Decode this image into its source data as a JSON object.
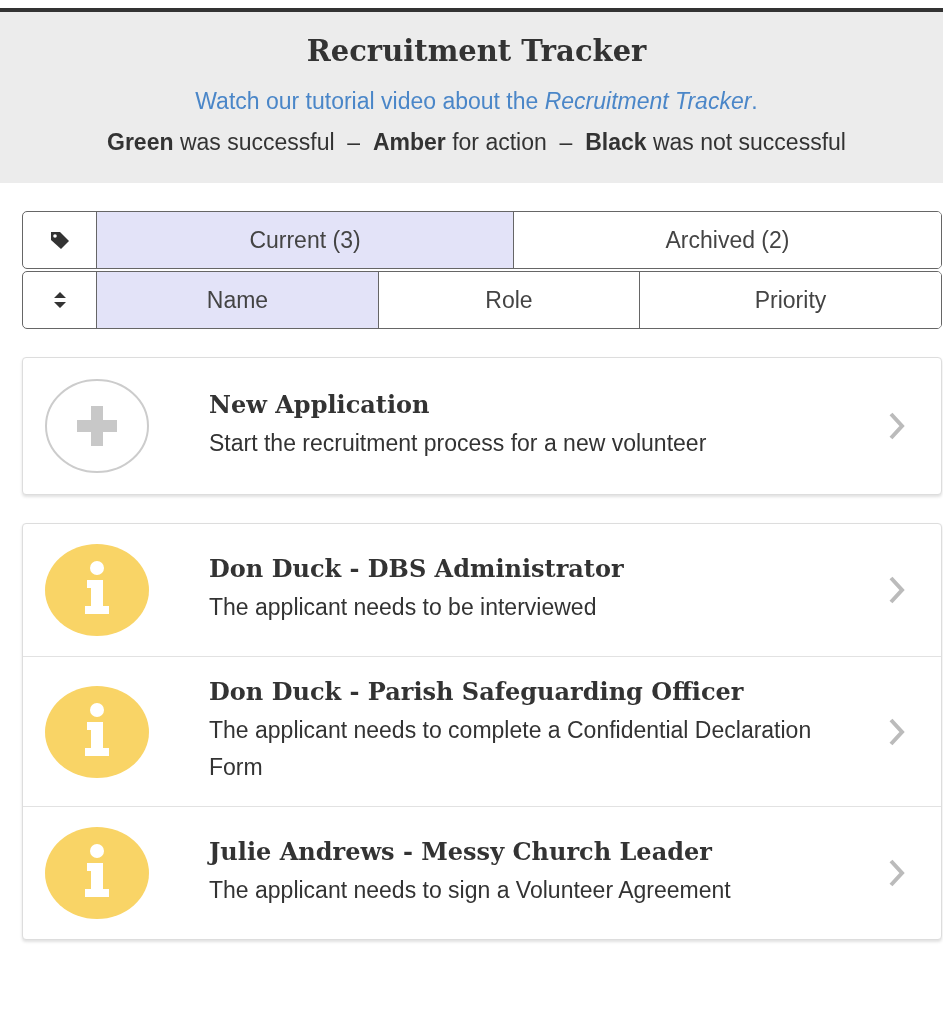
{
  "header": {
    "title": "Recruitment Tracker",
    "tutorial_link": "Watch our tutorial video about the *Recruitment Tracker*.",
    "legend": "**Green** was successful  –  **Amber** for action  –  **Black** was not successful"
  },
  "filter_tabs": [
    {
      "label": "Current (3)",
      "selected": true
    },
    {
      "label": "Archived (2)",
      "selected": false
    }
  ],
  "sort_tabs": [
    {
      "label": "Name",
      "selected": true
    },
    {
      "label": "Role",
      "selected": false
    },
    {
      "label": "Priority",
      "selected": false
    }
  ],
  "new_application": {
    "title": "New Application",
    "description": "Start the recruitment process for a new volunteer"
  },
  "applications": [
    {
      "title": "Don Duck - DBS Administrator",
      "status": "The applicant needs to be interviewed",
      "color": "#f9d466"
    },
    {
      "title": "Don Duck - Parish Safeguarding Officer",
      "status": "The applicant needs to complete a Confidential Declaration Form",
      "color": "#f9d466"
    },
    {
      "title": "Julie Andrews - Messy Church Leader",
      "status": "The applicant needs to sign a Volunteer Agreement",
      "color": "#f9d466"
    }
  ]
}
